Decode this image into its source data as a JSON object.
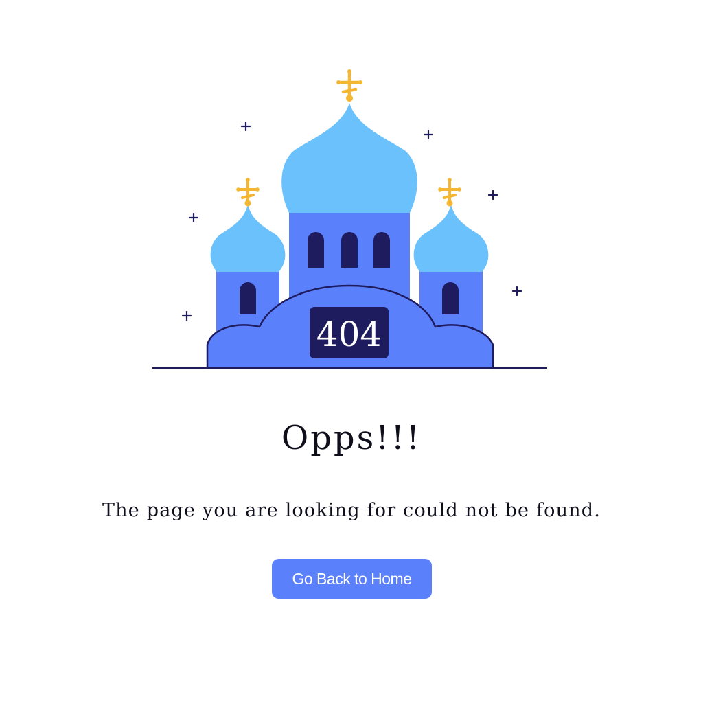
{
  "illustration": {
    "badge_text": "404"
  },
  "content": {
    "title": "Opps!!!",
    "message": "The page you are looking for could not be found."
  },
  "actions": {
    "home_button_label": "Go Back to Home"
  },
  "colors": {
    "dome": "#6bc1fc",
    "building": "#5b80fc",
    "dark": "#1e1b5e",
    "cross": "#f5b731",
    "button": "#5b80fc",
    "text": "#0e0f1a"
  }
}
